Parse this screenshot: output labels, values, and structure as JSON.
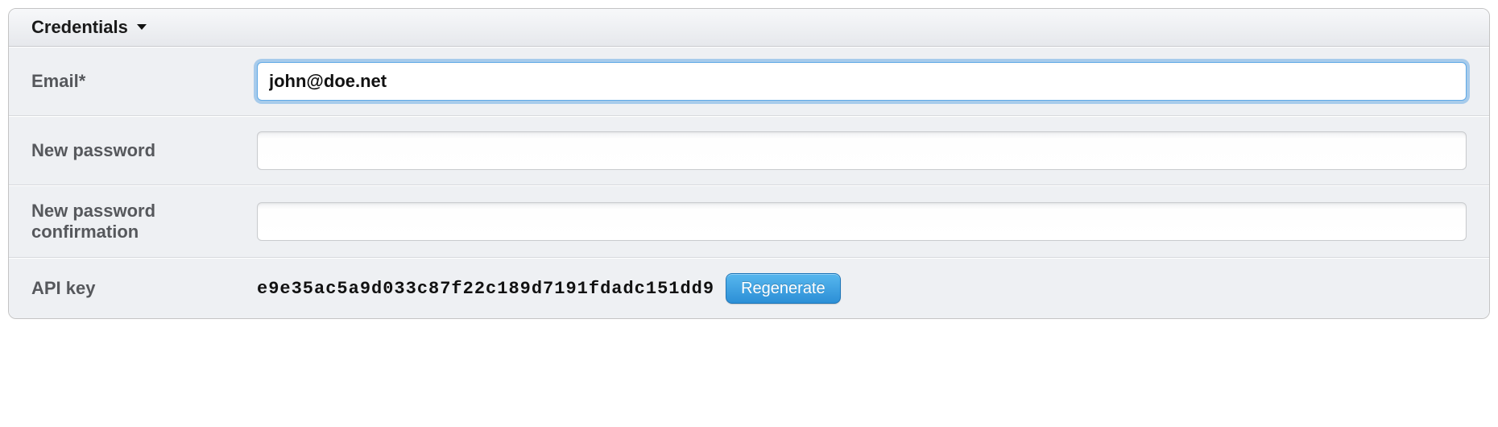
{
  "panel": {
    "title": "Credentials"
  },
  "fields": {
    "email": {
      "label": "Email*",
      "value": "john@doe.net"
    },
    "new_password": {
      "label": "New password",
      "value": ""
    },
    "new_password_confirmation": {
      "label": "New password confirmation",
      "value": ""
    },
    "api_key": {
      "label": "API key",
      "value": "e9e35ac5a9d033c87f22c189d7191fdadc151dd9",
      "regenerate_label": "Regenerate"
    }
  }
}
